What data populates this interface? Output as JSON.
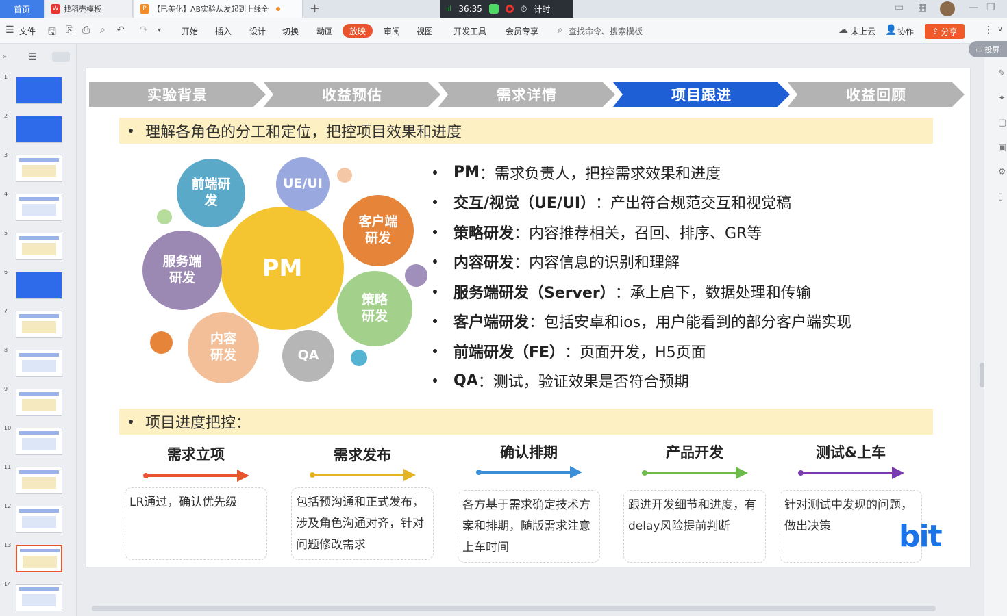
{
  "titlebar": {
    "home_tab": "首页",
    "tabs": [
      {
        "label": "找稻壳模板",
        "icon_color": "#e8342d"
      },
      {
        "label": "【已美化】AB实验从发起到上线全",
        "icon_color": "#f08c2a"
      }
    ],
    "new_tab": "+",
    "meeting": {
      "signal": "ııl",
      "time": "36:35",
      "timer_label": "计时"
    }
  },
  "toolbar": {
    "menu": "文件",
    "tabs": [
      "开始",
      "插入",
      "设计",
      "切换",
      "动画",
      "放映",
      "审阅",
      "视图",
      "开发工具",
      "会员专享"
    ],
    "active_tab": "放映",
    "search_placeholder": "查找命令、搜索模板",
    "cloud": "未上云",
    "collab": "协作",
    "share": "分享",
    "present": "投屏"
  },
  "thumbnails": {
    "numbers": [
      "1",
      "2",
      "3",
      "4",
      "5",
      "6",
      "7",
      "8",
      "9",
      "10",
      "11",
      "12",
      "13",
      "14"
    ],
    "selected": "13"
  },
  "slide": {
    "chevrons": [
      "实验背景",
      "收益预估",
      "需求详情",
      "项目跟进",
      "收益回顾"
    ],
    "active_chevron": "项目跟进",
    "section1_title": "理解各角色的分工和定位，把控项目效果和进度",
    "bubbles": {
      "pm": "PM",
      "fe": "前端研发",
      "ue": "UE/UI",
      "client": "客户端研发",
      "server": "服务端研发",
      "strategy": "策略研发",
      "content": "内容研发",
      "qa": "QA"
    },
    "roles": [
      {
        "name": "PM",
        "desc": "：需求负责人，把控需求效果和进度"
      },
      {
        "name": "交互/视觉（UE/UI）",
        "desc": "：产出符合规范交互和视觉稿"
      },
      {
        "name": "策略研发",
        "desc": "：内容推荐相关，召回、排序、GR等"
      },
      {
        "name": "内容研发",
        "desc": "：内容信息的识别和理解"
      },
      {
        "name": "服务端研发（Server）",
        "desc": "：承上启下，数据处理和传输"
      },
      {
        "name": "客户端研发",
        "desc": "：包括安卓和ios，用户能看到的部分客户端实现"
      },
      {
        "name": "前端研发（FE）",
        "desc": "：页面开发，H5页面"
      },
      {
        "name": "QA",
        "desc": "：测试，验证效果是否符合预期"
      }
    ],
    "section2_title": "项目进度把控：",
    "steps": [
      {
        "title": "需求立项",
        "text": "LR通过，确认优先级",
        "color": "#e8542d"
      },
      {
        "title": "需求发布",
        "text": "包括预沟通和正式发布，涉及角色沟通对齐，针对问题修改需求",
        "color": "#e6b422"
      },
      {
        "title": "确认排期",
        "text": "各方基于需求确定技术方案和排期，随版需求注意上车时间",
        "color": "#3b8fd6"
      },
      {
        "title": "产品开发",
        "text": "跟进开发细节和进度，有delay风险提前判断",
        "color": "#6dbb4a"
      },
      {
        "title": "测试&上车",
        "text": "针对测试中发现的问题，做出决策",
        "color": "#7b3bb0"
      }
    ],
    "logo": "bit"
  },
  "colors": {
    "accent": "#3f7ee8",
    "chevron_active": "#1f5fd6",
    "chevron_gray": "#b3b3b3",
    "highlight": "#fdf0c2"
  }
}
